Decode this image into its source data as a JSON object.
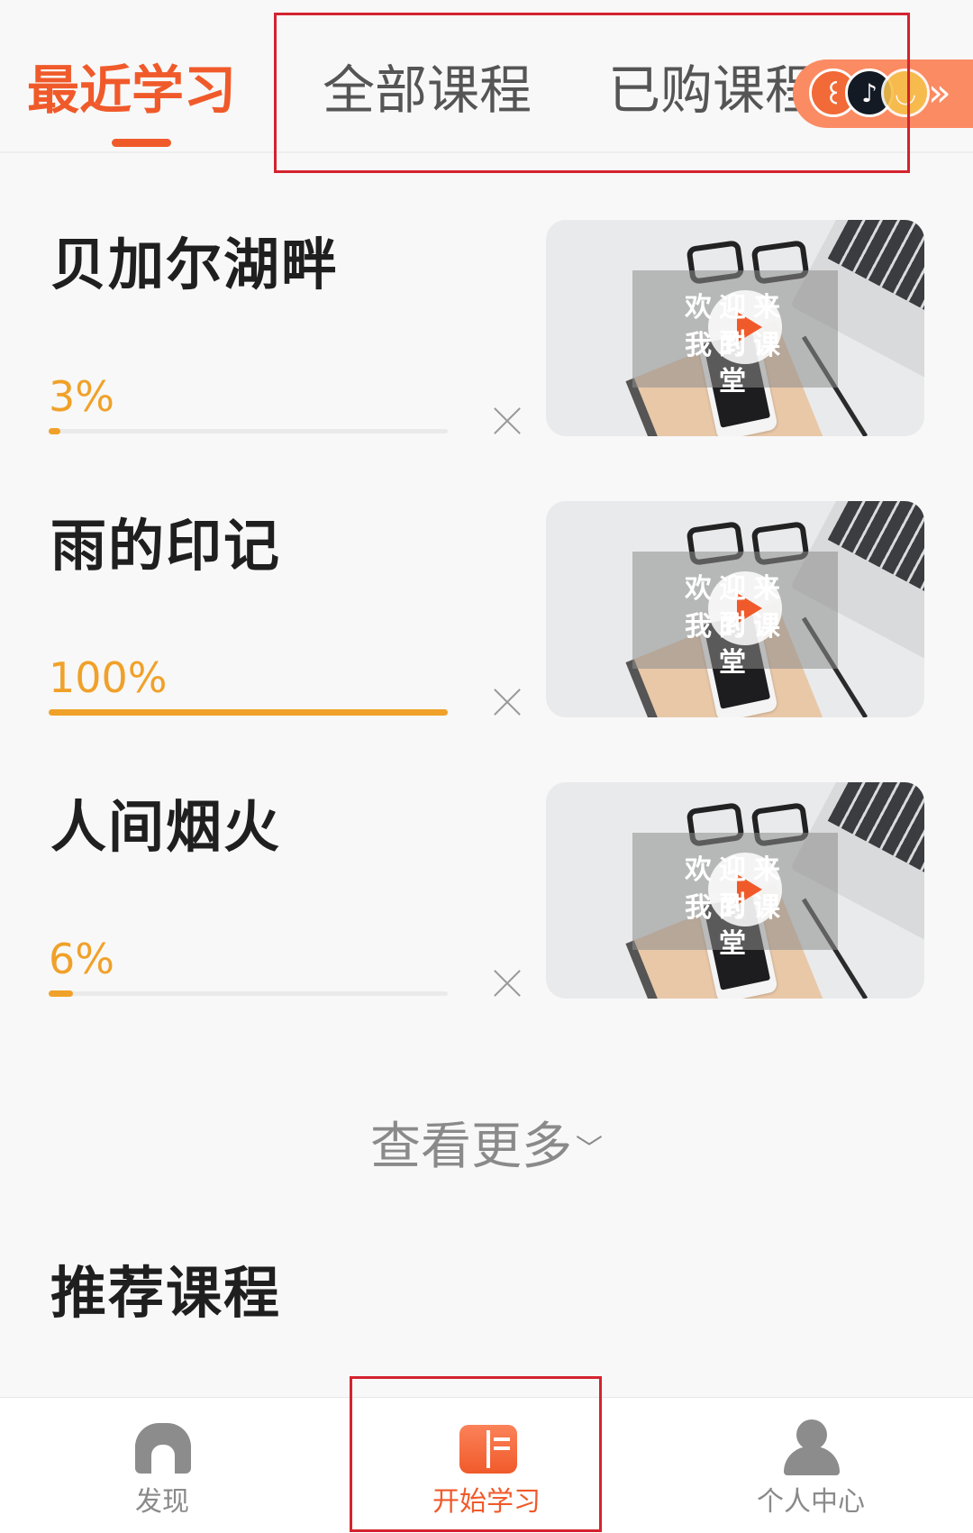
{
  "tabs": [
    {
      "label": "最近学习",
      "active": true
    },
    {
      "label": "全部课程",
      "active": false
    },
    {
      "label": "已购课程",
      "active": false
    }
  ],
  "float_widget": {
    "icons": [
      "app-icon-orange",
      "tiktok-icon",
      "yellow-app-icon"
    ],
    "arrow": "»"
  },
  "courses": [
    {
      "title": "贝加尔湖畔",
      "progress_label": "3%",
      "progress": 0.03,
      "thumb_text_1": "欢迎来到",
      "thumb_text_2": "我的课堂"
    },
    {
      "title": "雨的印记",
      "progress_label": "100%",
      "progress": 1.0,
      "thumb_text_1": "欢迎来到",
      "thumb_text_2": "我的课堂"
    },
    {
      "title": "人间烟火",
      "progress_label": "6%",
      "progress": 0.06,
      "thumb_text_1": "欢迎来到",
      "thumb_text_2": "我的课堂"
    }
  ],
  "more_label": "查看更多",
  "more_chevron": "﹀",
  "recommended_title": "推荐课程",
  "bottom_nav": [
    {
      "label": "发现",
      "icon": "home-icon",
      "active": false
    },
    {
      "label": "开始学习",
      "icon": "book-icon",
      "active": true
    },
    {
      "label": "个人中心",
      "icon": "user-icon",
      "active": false
    }
  ],
  "colors": {
    "accent": "#f05a2a",
    "progress": "#f0a12a",
    "highlight_box": "#d4232f"
  }
}
